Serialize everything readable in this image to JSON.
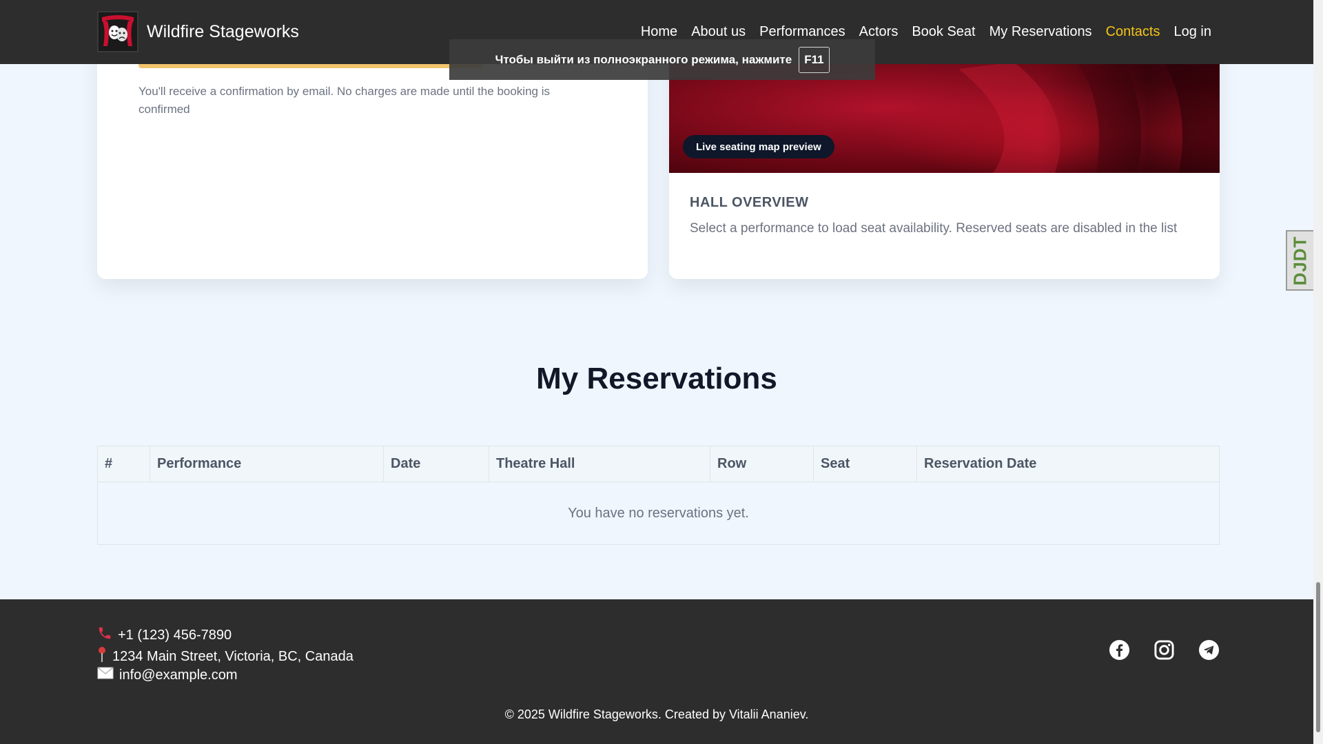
{
  "header": {
    "brand_name": "Wildfire Stageworks",
    "nav": [
      {
        "label": "Home",
        "active": false
      },
      {
        "label": "About us",
        "active": false
      },
      {
        "label": "Performances",
        "active": false
      },
      {
        "label": "Actors",
        "active": false
      },
      {
        "label": "Book Seat",
        "active": false
      },
      {
        "label": "My Reservations",
        "active": false
      },
      {
        "label": "Contacts",
        "active": true
      },
      {
        "label": "Log in",
        "active": false
      }
    ]
  },
  "fullscreen_notice": {
    "text": "Чтобы выйти из полноэкранного режима, нажмите",
    "key": "F11"
  },
  "booking_card": {
    "note": "You'll receive a confirmation by email. No charges are made until the booking is confirmed"
  },
  "hall_card": {
    "preview_label": "Live seating map preview",
    "title": "HALL OVERVIEW",
    "description": "Select a performance to load seat availability. Reserved seats are disabled in the list"
  },
  "reservations": {
    "title": "My Reservations",
    "columns": [
      "#",
      "Performance",
      "Date",
      "Theatre Hall",
      "Row",
      "Seat",
      "Reservation Date"
    ],
    "empty_message": "You have no reservations yet."
  },
  "footer": {
    "phone": "+1 (123) 456-7890",
    "address": "1234 Main Street, Victoria, BC, Canada",
    "email": "info@example.com",
    "socials": [
      "facebook-icon",
      "instagram-icon",
      "telegram-icon"
    ],
    "copyright": "© 2025 Wildfire Stageworks. Created by Vitalii Ananiev."
  },
  "debug_toolbar": {
    "label": "DJDT"
  },
  "colors": {
    "accent": "#f5c518",
    "header_bg": "#2d2d2d",
    "page_bg": "#eff6fe"
  }
}
